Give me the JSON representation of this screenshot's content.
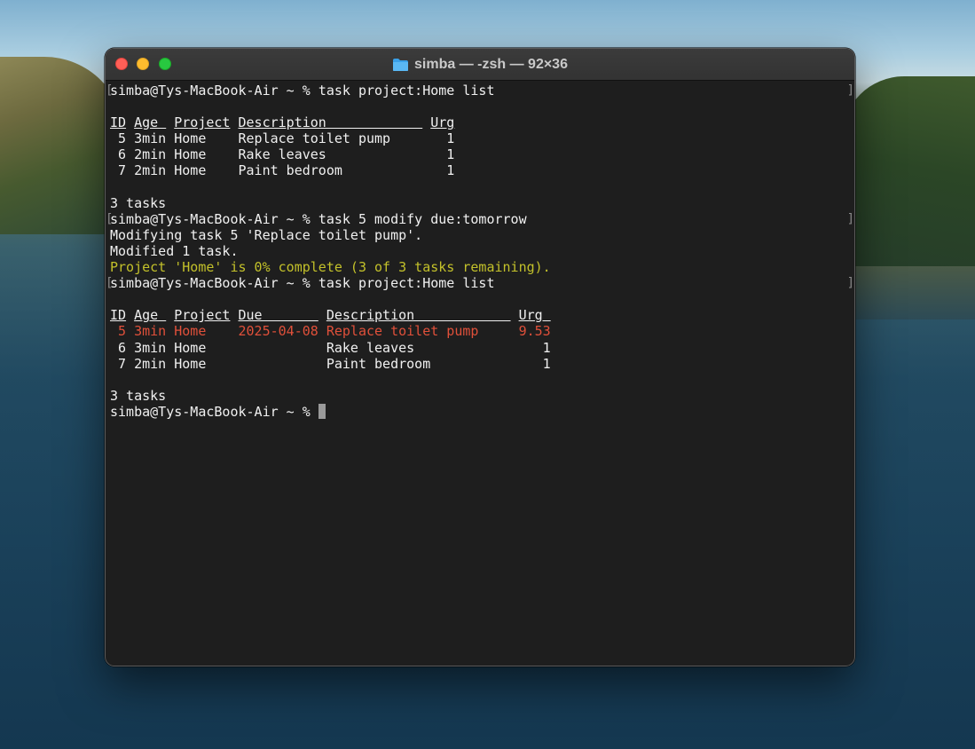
{
  "window": {
    "title": "simba — -zsh — 92×36",
    "icon": "folder-icon"
  },
  "terminal": {
    "lines": [
      {
        "type": "cmd",
        "prompt": "simba@Tys-MacBook-Air ~ % ",
        "command": "task project:Home list"
      },
      {
        "type": "blank"
      },
      {
        "type": "header",
        "cols": [
          "ID",
          "Age",
          "Project",
          "Description",
          "Urg"
        ]
      },
      {
        "type": "row",
        "cols": [
          " 5",
          "3min",
          "Home",
          "Replace toilet pump",
          "1"
        ]
      },
      {
        "type": "row",
        "cols": [
          " 6",
          "2min",
          "Home",
          "Rake leaves",
          "1"
        ]
      },
      {
        "type": "row",
        "cols": [
          " 7",
          "2min",
          "Home",
          "Paint bedroom",
          "1"
        ]
      },
      {
        "type": "blank"
      },
      {
        "type": "text",
        "text": "3 tasks"
      },
      {
        "type": "cmd",
        "prompt": "simba@Tys-MacBook-Air ~ % ",
        "command": "task 5 modify due:tomorrow"
      },
      {
        "type": "text",
        "text": "Modifying task 5 'Replace toilet pump'."
      },
      {
        "type": "text",
        "text": "Modified 1 task."
      },
      {
        "type": "warn",
        "text": "Project 'Home' is 0% complete (3 of 3 tasks remaining)."
      },
      {
        "type": "cmd",
        "prompt": "simba@Tys-MacBook-Air ~ % ",
        "command": "task project:Home list"
      },
      {
        "type": "blank"
      },
      {
        "type": "header2",
        "cols": [
          "ID",
          "Age",
          "Project",
          "Due",
          "Description",
          "Urg"
        ]
      },
      {
        "type": "row2-red",
        "cols": [
          " 5",
          "3min",
          "Home",
          "2025-04-08",
          "Replace toilet pump",
          "9.53"
        ]
      },
      {
        "type": "row2",
        "cols": [
          " 6",
          "3min",
          "Home",
          "",
          "Rake leaves",
          "1"
        ]
      },
      {
        "type": "row2",
        "cols": [
          " 7",
          "2min",
          "Home",
          "",
          "Paint bedroom",
          "1"
        ]
      },
      {
        "type": "blank"
      },
      {
        "type": "text",
        "text": "3 tasks"
      },
      {
        "type": "prompt",
        "prompt": "simba@Tys-MacBook-Air ~ % "
      }
    ]
  },
  "colors": {
    "background": "#1e1e1e",
    "text": "#f0f0f0",
    "warning": "#c3c12a",
    "overdue": "#e0503a",
    "close": "#ff5f57",
    "minimize": "#febc2e",
    "zoom": "#28c840"
  }
}
